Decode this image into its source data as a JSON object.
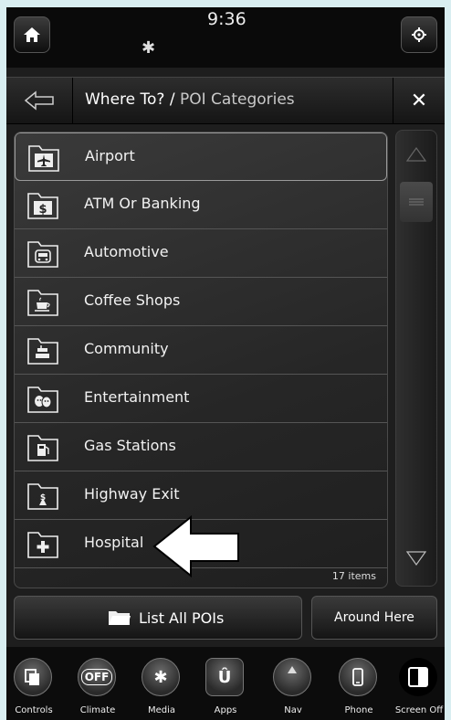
{
  "status": {
    "time": "9:36",
    "bluetooth_icon": "bluetooth-icon"
  },
  "titlebar": {
    "title_main": "Where To? / ",
    "title_sub": "POI Categories"
  },
  "list": {
    "items": [
      {
        "label": "Airport",
        "icon": "airplane-icon"
      },
      {
        "label": "ATM Or Banking",
        "icon": "dollar-icon"
      },
      {
        "label": "Automotive",
        "icon": "car-icon"
      },
      {
        "label": "Coffee Shops",
        "icon": "coffee-cup-icon"
      },
      {
        "label": "Community",
        "icon": "community-icon"
      },
      {
        "label": "Entertainment",
        "icon": "theater-masks-icon"
      },
      {
        "label": "Gas Stations",
        "icon": "fuel-pump-icon"
      },
      {
        "label": "Highway Exit",
        "icon": "highway-exit-icon"
      },
      {
        "label": "Hospital",
        "icon": "medical-cross-icon"
      }
    ],
    "count_label": "17 items",
    "selected_index": 0
  },
  "buttons": {
    "list_all": "List All POIs",
    "around_here": "Around Here"
  },
  "dock": [
    {
      "label": "Controls",
      "icon": "controls-icon"
    },
    {
      "label": "Climate",
      "icon": "climate-off-icon",
      "text": "OFF"
    },
    {
      "label": "Media",
      "icon": "bluetooth-icon"
    },
    {
      "label": "Apps",
      "icon": "apps-icon"
    },
    {
      "label": "Nav",
      "icon": "nav-icon"
    },
    {
      "label": "Phone",
      "icon": "phone-icon"
    },
    {
      "label": "Screen Off",
      "icon": "screen-off-icon"
    }
  ],
  "colors": {
    "background": "#1e1e1e",
    "text": "#ffffff",
    "outer_border": "#d9eef1"
  }
}
